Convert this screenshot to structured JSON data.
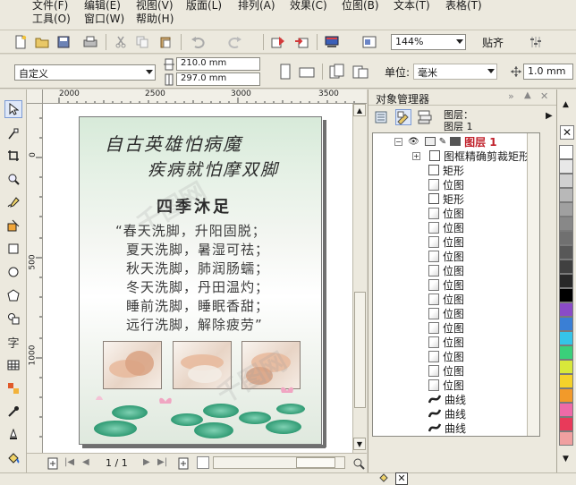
{
  "menu": [
    {
      "label": "文件(F)"
    },
    {
      "label": "编辑(E)"
    },
    {
      "label": "视图(V)"
    },
    {
      "label": "版面(L)"
    },
    {
      "label": "排列(A)"
    },
    {
      "label": "效果(C)"
    },
    {
      "label": "位图(B)"
    },
    {
      "label": "文本(T)"
    },
    {
      "label": "表格(T)"
    },
    {
      "label": "工具(O)"
    },
    {
      "label": "窗口(W)"
    },
    {
      "label": "帮助(H)"
    }
  ],
  "toolbar": {
    "zoom_value": "144%",
    "snap_label": "贴齐"
  },
  "property_bar": {
    "paper_preset": "自定义",
    "width": "210.0 mm",
    "height": "297.0 mm",
    "unit_label": "单位:",
    "unit_value": "毫米",
    "nudge_value": "1.0 mm"
  },
  "rulers": {
    "top_labels": [
      "2000",
      "2500",
      "3000",
      "3500"
    ],
    "left_labels": [
      "0",
      "500",
      "1000"
    ]
  },
  "poster": {
    "calligraphy_line1": "自古英雄怕病魔",
    "calligraphy_line2": "疾病就怕摩双脚",
    "title": "四季沐足",
    "poem": [
      "“春天洗脚，升阳固脱；",
      "夏天洗脚，暑湿可祛；",
      "秋天洗脚，肺润肠蠕；",
      "冬天洗脚，丹田温灼；",
      "睡前洗脚，睡眠香甜；",
      "远行洗脚，解除疲劳”"
    ]
  },
  "page_nav": {
    "page_counter": "1 / 1"
  },
  "docker": {
    "title": "对象管理器",
    "layer_header_line1": "图层：",
    "layer_header_line2": "图层 1",
    "layer_name": "图层 1",
    "items": [
      {
        "label": "图框精确剪裁矩形",
        "icon": "box-icon"
      },
      {
        "label": "矩形",
        "icon": "box-icon"
      },
      {
        "label": "位图",
        "icon": "bitmap-icon"
      },
      {
        "label": "矩形",
        "icon": "box-icon"
      },
      {
        "label": "位图",
        "icon": "bitmap-icon"
      },
      {
        "label": "位图",
        "icon": "bitmap-icon"
      },
      {
        "label": "位图",
        "icon": "bitmap-icon"
      },
      {
        "label": "位图",
        "icon": "bitmap-icon"
      },
      {
        "label": "位图",
        "icon": "bitmap-icon"
      },
      {
        "label": "位图",
        "icon": "bitmap-icon"
      },
      {
        "label": "位图",
        "icon": "bitmap-icon"
      },
      {
        "label": "位图",
        "icon": "bitmap-icon"
      },
      {
        "label": "位图",
        "icon": "bitmap-icon"
      },
      {
        "label": "位图",
        "icon": "bitmap-icon"
      },
      {
        "label": "位图",
        "icon": "bitmap-icon"
      },
      {
        "label": "位图",
        "icon": "bitmap-icon"
      },
      {
        "label": "位图",
        "icon": "bitmap-icon"
      },
      {
        "label": "曲线",
        "icon": "curve-icon"
      },
      {
        "label": "曲线",
        "icon": "curve-icon"
      },
      {
        "label": "曲线",
        "icon": "curve-icon"
      }
    ]
  },
  "palette": {
    "colors": [
      "#ffffff",
      "#e8e8e8",
      "#d0d0d0",
      "#b8b8b8",
      "#a0a0a0",
      "#888888",
      "#707070",
      "#585858",
      "#404040",
      "#282828",
      "#000000",
      "#8a4bc7",
      "#3a7fd5",
      "#35c4e8",
      "#3ad07a",
      "#d8e83a",
      "#f5d22a",
      "#f29a2a",
      "#ee6aa8",
      "#e83a5a",
      "#f0a0a0"
    ]
  },
  "watermark": "千图网"
}
